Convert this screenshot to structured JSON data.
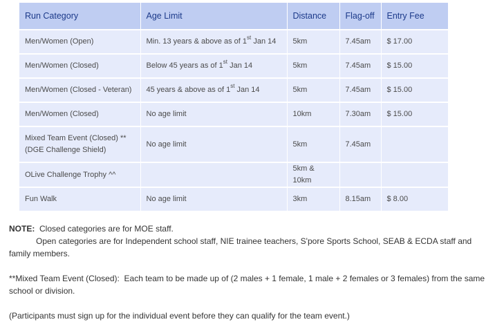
{
  "table": {
    "headers": [
      "Run Category",
      "Age Limit",
      "Distance",
      "Flag-off",
      "Entry Fee"
    ],
    "rows": [
      {
        "category": [
          "Men/Women (Open)"
        ],
        "age_pre": "Min. 13 years & above as of 1",
        "age_sup": "st",
        "age_post": " Jan 14",
        "distance": "5km",
        "flagoff": "7.45am",
        "fee": "$ 17.00"
      },
      {
        "category": [
          "Men/Women (Closed)"
        ],
        "age_pre": "Below 45 years as of 1",
        "age_sup": "st",
        "age_post": " Jan 14",
        "distance": "5km",
        "flagoff": "7.45am",
        "fee": "$ 15.00"
      },
      {
        "category": [
          "Men/Women (Closed - Veteran)"
        ],
        "age_pre": "45 years & above as of 1",
        "age_sup": "st",
        "age_post": " Jan 14",
        "distance": "5km",
        "flagoff": "7.45am",
        "fee": "$ 15.00"
      },
      {
        "category": [
          "Men/Women (Closed)"
        ],
        "age_pre": "No age limit",
        "age_sup": "",
        "age_post": "",
        "distance": "10km",
        "flagoff": "7.30am",
        "fee": "$ 15.00"
      },
      {
        "category": [
          "Mixed Team Event (Closed) **",
          "(DGE Challenge Shield)"
        ],
        "age_pre": "No age limit",
        "age_sup": "",
        "age_post": "",
        "distance": "5km",
        "flagoff": "7.45am",
        "fee": ""
      },
      {
        "category": [
          "OLive Challenge Trophy ^^"
        ],
        "age_pre": "",
        "age_sup": "",
        "age_post": "",
        "distance": "5km & 10km",
        "flagoff": "",
        "fee": ""
      },
      {
        "category": [
          "Fun Walk"
        ],
        "age_pre": "No age limit",
        "age_sup": "",
        "age_post": "",
        "distance": "3km",
        "flagoff": "8.15am",
        "fee": "$ 8.00"
      }
    ]
  },
  "notes": {
    "note_label": "NOTE:",
    "note_line1": "Closed categories are for MOE staff.",
    "note_line2": "Open categories are for Independent school staff, NIE trainee teachers, S'pore Sports School, SEAB & ECDA staff and family members.",
    "mixed_label": "**Mixed Team Event (Closed):",
    "mixed_text": "Each team to be made up of (2 males + 1 female, 1 male + 2 females or 3 females) from the same school or division.",
    "participants_text": "(Participants must sign up for the individual event before they can qualify for the team event.)"
  }
}
